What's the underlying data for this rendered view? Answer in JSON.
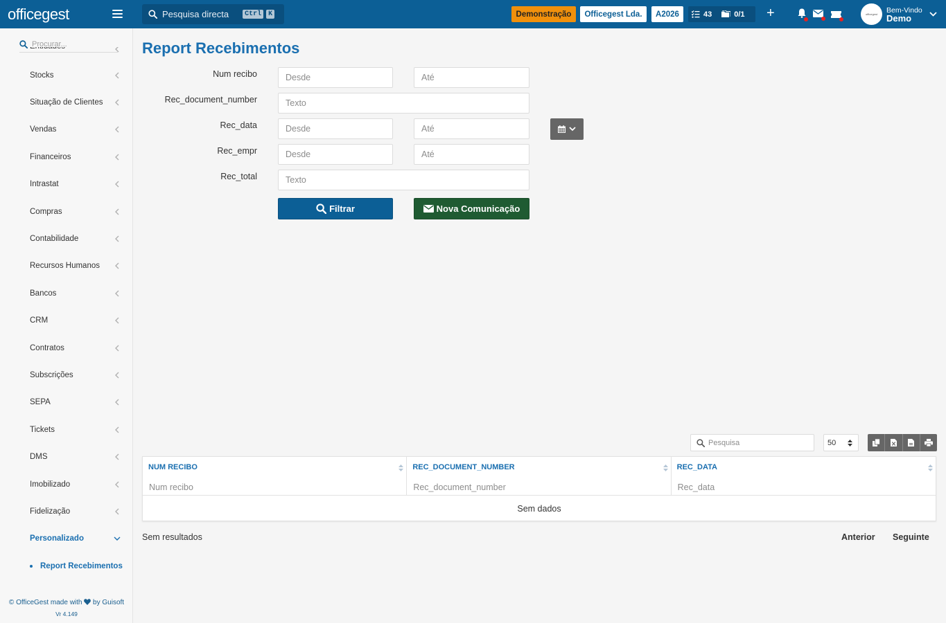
{
  "header": {
    "logo": "officegest",
    "search_label": "Pesquisa directa",
    "kbd_ctrl": "Ctrl",
    "kbd_k": "K",
    "demo_badge": "Demonstração",
    "company": "Officegest Lda.",
    "year": "A2026",
    "tasks_count": "43",
    "folders_count": "0/1",
    "welcome": "Bem-Vindo",
    "user": "Demo",
    "avatar_text": "officegest"
  },
  "sidebar": {
    "search_placeholder": "Procurar...",
    "items": [
      {
        "label": "Entidades"
      },
      {
        "label": "Stocks"
      },
      {
        "label": "Situação de Clientes"
      },
      {
        "label": "Vendas"
      },
      {
        "label": "Financeiros"
      },
      {
        "label": "Intrastat"
      },
      {
        "label": "Compras"
      },
      {
        "label": "Contabilidade"
      },
      {
        "label": "Recursos Humanos"
      },
      {
        "label": "Bancos"
      },
      {
        "label": "CRM"
      },
      {
        "label": "Contratos"
      },
      {
        "label": "Subscrições"
      },
      {
        "label": "SEPA"
      },
      {
        "label": "Tickets"
      },
      {
        "label": "DMS"
      },
      {
        "label": "Imobilizado"
      },
      {
        "label": "Fidelização"
      },
      {
        "label": "Personalizado"
      }
    ],
    "subitem": "Report Recebimentos",
    "footer_prefix": "© OfficeGest made with",
    "footer_suffix": "by Guisoft",
    "version": "Vr 4.149"
  },
  "page": {
    "title": "Report Recebimentos"
  },
  "filters": {
    "num_recibo_label": "Num recibo",
    "doc_number_label": "Rec_document_number",
    "rec_data_label": "Rec_data",
    "rec_empr_label": "Rec_empr",
    "rec_total_label": "Rec_total",
    "from_placeholder": "Desde",
    "to_placeholder": "Até",
    "text_placeholder": "Texto",
    "filter_button": "Filtrar",
    "new_comm_button": "Nova Comunicação"
  },
  "table": {
    "search_placeholder": "Pesquisa",
    "page_size": "50",
    "columns": [
      {
        "header": "NUM RECIBO",
        "filter_placeholder": "Num recibo"
      },
      {
        "header": "REC_DOCUMENT_NUMBER",
        "filter_placeholder": "Rec_document_number"
      },
      {
        "header": "REC_DATA",
        "filter_placeholder": "Rec_data"
      }
    ],
    "empty_text": "Sem dados",
    "results_text": "Sem resultados",
    "prev_label": "Anterior",
    "next_label": "Seguinte"
  },
  "colors": {
    "primary": "#0c5f96",
    "title_blue": "#1a6fb0",
    "demo_orange": "#f0900c",
    "green_button": "#1f5b32",
    "grey_button": "#666666"
  }
}
